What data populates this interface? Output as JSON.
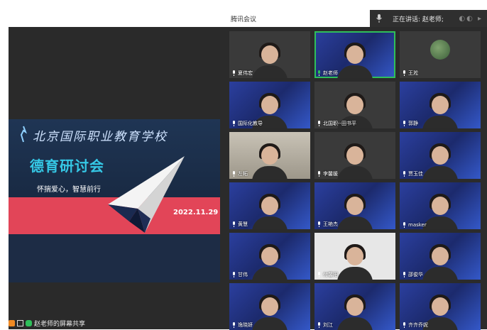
{
  "window": {
    "title": "腾讯会议"
  },
  "speaking_banner": {
    "label": "正在讲话: 赵老师;"
  },
  "share": {
    "slide": {
      "school": "北京国际职业教育学校",
      "meeting_title": "德育研讨会",
      "slogan": "怀揣爱心，智慧前行",
      "date": "2022.11.29"
    },
    "sharer_label": "赵老师的屏幕共享"
  },
  "participants": [
    {
      "name": "夏伟宏",
      "style": "dark"
    },
    {
      "name": "赵老师",
      "style": "blue",
      "speaking": true
    },
    {
      "name": "王淞",
      "style": "dark",
      "avatar": true
    },
    {
      "name": "国际化教导",
      "style": "blue"
    },
    {
      "name": "北国职--田书平",
      "style": "dark"
    },
    {
      "name": "郭静",
      "style": "blue"
    },
    {
      "name": "左柘",
      "style": "room"
    },
    {
      "name": "李馨媛",
      "style": "dark"
    },
    {
      "name": "贾玉佳",
      "style": "blue"
    },
    {
      "name": "黄慧",
      "style": "blue"
    },
    {
      "name": "王艳杰",
      "style": "blue"
    },
    {
      "name": "masker",
      "style": "blue"
    },
    {
      "name": "甘伟",
      "style": "blue"
    },
    {
      "name": "付馨阳",
      "style": "white"
    },
    {
      "name": "邵俊华",
      "style": "blue"
    },
    {
      "name": "逸晓妍",
      "style": "blue"
    },
    {
      "name": "刘江",
      "style": "blue"
    },
    {
      "name": "齐齐乔妮",
      "style": "blue"
    }
  ]
}
